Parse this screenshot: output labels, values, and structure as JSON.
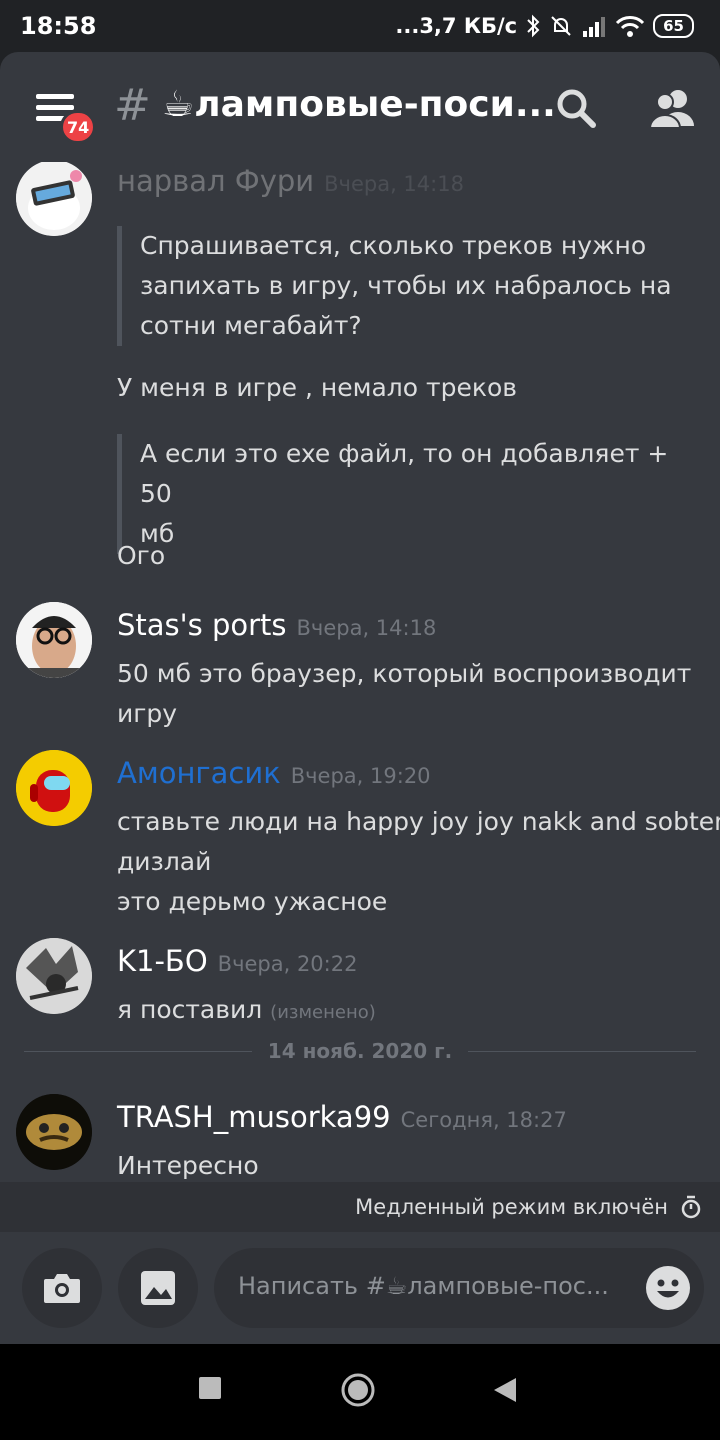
{
  "status_bar": {
    "time": "18:58",
    "speed": "...3,7 КБ/с",
    "battery": "65"
  },
  "header": {
    "unread_badge": "74",
    "hash_symbol": "#",
    "channel_name": "☕ламповые-поси..."
  },
  "messages": [
    {
      "author": "нарвал Фури",
      "timestamp": "Вчера, 14:18",
      "author_color": "#dcddde",
      "quote1": [
        "Спрашивается, сколько треков нужно",
        "запихать в игру, чтобы их набралось на",
        "сотни мегабайт?"
      ],
      "line1": "У меня в игре , немало треков",
      "quote2": [
        "А если это exe файл, то он добавляет + 50",
        "мб"
      ],
      "line2": "Ого"
    },
    {
      "author": "Stas's ports",
      "timestamp": "Вчера, 14:18",
      "lines": [
        "50 мб это браузер, который воспроизводит",
        "игру"
      ]
    },
    {
      "author": "Амонгасик",
      "timestamp": "Вчера, 19:20",
      "author_color": "#1f6fd1",
      "lines": [
        "ставьте люди на happy joy joy nakk and sobten",
        "дизлай",
        "это дерьмо ужасное"
      ]
    },
    {
      "author": "K1-БО",
      "timestamp": "Вчера, 20:22",
      "line": "я поставил",
      "edited": "(изменено)"
    }
  ],
  "date_divider": "14 нояб. 2020 г.",
  "latest_message": {
    "author": "TRASH_musorka99",
    "timestamp": "Сегодня, 18:27",
    "line": "Интересно"
  },
  "slowmode": {
    "label": "Медленный режим включён"
  },
  "composer": {
    "placeholder": "Написать #☕ламповые-пос..."
  },
  "icons": [
    "menu-icon",
    "search-icon",
    "members-icon",
    "camera-icon",
    "image-icon",
    "emoji-icon",
    "timer-icon",
    "nav-square-icon",
    "nav-circle-icon",
    "nav-back-icon"
  ],
  "colors": {
    "background": "#36393f",
    "sidebar": "#202225",
    "badge": "#ed4245",
    "link_blue": "#1f6fd1"
  }
}
